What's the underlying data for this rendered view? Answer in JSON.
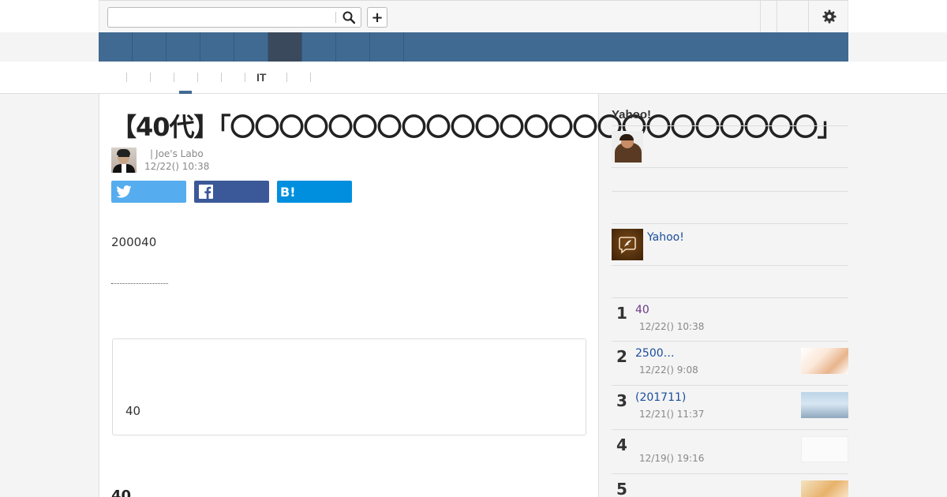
{
  "search": {
    "placeholder": "",
    "value": ""
  },
  "header": {
    "plus_label": "+"
  },
  "subnav": {
    "it_label": "IT"
  },
  "article": {
    "headline": "【40代】「〇〇〇〇〇〇〇〇〇〇〇〇〇〇〇〇〇〇〇〇〇〇〇〇」",
    "source": "Joe's Labo",
    "datetime": "12/22() 10:38",
    "body_first": "200040",
    "box_text": "40",
    "section_heading": "40"
  },
  "share": {
    "hatena_label": "B!"
  },
  "sidebar": {
    "title": "Yahoo!",
    "yahoo_link": "Yahoo!",
    "ranking": [
      {
        "num": "1",
        "title": "40",
        "date": "12/22() 10:38",
        "visited": true
      },
      {
        "num": "2",
        "title": "2500…",
        "date": "12/22() 9:08",
        "visited": false
      },
      {
        "num": "3",
        "title": "(201711)",
        "date": "12/21() 11:37",
        "visited": false
      },
      {
        "num": "4",
        "title": "",
        "date": "12/19() 19:16",
        "visited": false
      },
      {
        "num": "5",
        "title": "",
        "date": "",
        "visited": false
      }
    ]
  },
  "colors": {
    "nav": "#416a92",
    "nav_active": "#3a4a5c",
    "twitter": "#55acee",
    "facebook": "#3b5998",
    "hatena": "#008fde",
    "link": "#1a4d9c"
  },
  "icons": [
    "search-icon",
    "plus-icon",
    "gear-icon",
    "twitter-icon",
    "facebook-icon",
    "hatena-icon",
    "yahoo-pen-icon"
  ]
}
